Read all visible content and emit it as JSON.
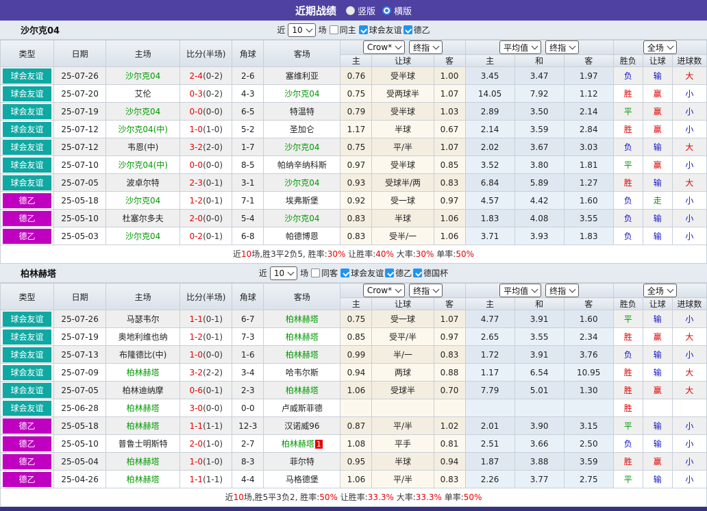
{
  "title_bar": {
    "title": "近期战绩",
    "vertical": "竖版",
    "horizontal": "横版"
  },
  "colors": {
    "accent_purple": "#4e41a1",
    "bottom_bar": "#38317d",
    "friendly_teal": "#0fa8a2",
    "league2_magenta": "#c000c0",
    "team_highlight_green": "#009900",
    "score_red": "#e60000",
    "win_red": "#dd0000",
    "lose_blue": "#1414cc",
    "draw_green": "#009900"
  },
  "table_header": {
    "type": "类型",
    "date": "日期",
    "home": "主场",
    "score": "比分(半场)",
    "corner": "角球",
    "away": "客场",
    "crow": "Crow*",
    "final": "终指",
    "avg": "平均值",
    "final2": "终指",
    "full": "全场",
    "h": "主",
    "handicap": "让球",
    "a": "客",
    "avg_h": "主",
    "avg_d": "和",
    "avg_a": "客",
    "wdl": "胜负",
    "let": "让球",
    "goals": "进球数"
  },
  "sections": [
    {
      "team": "沙尔克04",
      "filter": {
        "near": "近",
        "count": "10",
        "games": "场",
        "same": "同主",
        "leagues": [
          "球会友谊",
          "德乙"
        ]
      },
      "rows": [
        {
          "type": "球会友谊",
          "type_color": "#0fa8a2",
          "date": "25-07-26",
          "home": "沙尔克04",
          "home_hl": 1,
          "score": "2-4",
          "half": "(0-2)",
          "corners": "2-6",
          "away": "塞维利亚",
          "away_hl": 0,
          "away_badge": "",
          "crow_home": "0.76",
          "crow_line": "受半球",
          "crow_away": "1.00",
          "avg_home": "3.45",
          "avg_draw": "3.47",
          "avg_away": "1.97",
          "res_wdl": "负",
          "res_handicap": "输",
          "res_goals": "大"
        },
        {
          "type": "球会友谊",
          "type_color": "#0fa8a2",
          "date": "25-07-20",
          "home": "艾伦",
          "home_hl": 0,
          "score": "0-3",
          "half": "(0-2)",
          "corners": "4-3",
          "away": "沙尔克04",
          "away_hl": 1,
          "away_badge": "",
          "crow_home": "0.75",
          "crow_line": "受两球半",
          "crow_away": "1.07",
          "avg_home": "14.05",
          "avg_draw": "7.92",
          "avg_away": "1.12",
          "res_wdl": "胜",
          "res_handicap": "赢",
          "res_goals": "小"
        },
        {
          "type": "球会友谊",
          "type_color": "#0fa8a2",
          "date": "25-07-19",
          "home": "沙尔克04",
          "home_hl": 1,
          "score": "0-0",
          "half": "(0-0)",
          "corners": "6-5",
          "away": "特温特",
          "away_hl": 0,
          "away_badge": "",
          "crow_home": "0.79",
          "crow_line": "受半球",
          "crow_away": "1.03",
          "avg_home": "2.89",
          "avg_draw": "3.50",
          "avg_away": "2.14",
          "res_wdl": "平",
          "res_handicap": "赢",
          "res_goals": "小"
        },
        {
          "type": "球会友谊",
          "type_color": "#0fa8a2",
          "date": "25-07-12",
          "home": "沙尔克04(中)",
          "home_hl": 1,
          "score": "1-0",
          "half": "(1-0)",
          "corners": "5-2",
          "away": "圣加仑",
          "away_hl": 0,
          "away_badge": "",
          "crow_home": "1.17",
          "crow_line": "半球",
          "crow_away": "0.67",
          "avg_home": "2.14",
          "avg_draw": "3.59",
          "avg_away": "2.84",
          "res_wdl": "胜",
          "res_handicap": "赢",
          "res_goals": "小"
        },
        {
          "type": "球会友谊",
          "type_color": "#0fa8a2",
          "date": "25-07-12",
          "home": "韦恩(中)",
          "home_hl": 0,
          "score": "3-2",
          "half": "(2-0)",
          "corners": "1-7",
          "away": "沙尔克04",
          "away_hl": 1,
          "away_badge": "",
          "crow_home": "0.75",
          "crow_line": "平/半",
          "crow_away": "1.07",
          "avg_home": "2.02",
          "avg_draw": "3.67",
          "avg_away": "3.03",
          "res_wdl": "负",
          "res_handicap": "输",
          "res_goals": "大"
        },
        {
          "type": "球会友谊",
          "type_color": "#0fa8a2",
          "date": "25-07-10",
          "home": "沙尔克04(中)",
          "home_hl": 1,
          "score": "0-0",
          "half": "(0-0)",
          "corners": "8-5",
          "away": "帕纳辛纳科斯",
          "away_hl": 0,
          "away_badge": "",
          "crow_home": "0.97",
          "crow_line": "受半球",
          "crow_away": "0.85",
          "avg_home": "3.52",
          "avg_draw": "3.80",
          "avg_away": "1.81",
          "res_wdl": "平",
          "res_handicap": "赢",
          "res_goals": "小"
        },
        {
          "type": "球会友谊",
          "type_color": "#0fa8a2",
          "date": "25-07-05",
          "home": "波卓尔特",
          "home_hl": 0,
          "score": "2-3",
          "half": "(0-1)",
          "corners": "3-1",
          "away": "沙尔克04",
          "away_hl": 1,
          "away_badge": "",
          "crow_home": "0.93",
          "crow_line": "受球半/两",
          "crow_away": "0.83",
          "avg_home": "6.84",
          "avg_draw": "5.89",
          "avg_away": "1.27",
          "res_wdl": "胜",
          "res_handicap": "输",
          "res_goals": "大"
        },
        {
          "type": "德乙",
          "type_color": "#c000c0",
          "date": "25-05-18",
          "home": "沙尔克04",
          "home_hl": 1,
          "score": "1-2",
          "half": "(0-1)",
          "corners": "7-1",
          "away": "埃弗斯堡",
          "away_hl": 0,
          "away_badge": "",
          "crow_home": "0.92",
          "crow_line": "受一球",
          "crow_away": "0.97",
          "avg_home": "4.57",
          "avg_draw": "4.42",
          "avg_away": "1.60",
          "res_wdl": "负",
          "res_handicap": "走",
          "res_goals": "小"
        },
        {
          "type": "德乙",
          "type_color": "#c000c0",
          "date": "25-05-10",
          "home": "杜塞尔多夫",
          "home_hl": 0,
          "score": "2-0",
          "half": "(0-0)",
          "corners": "5-4",
          "away": "沙尔克04",
          "away_hl": 1,
          "away_badge": "",
          "crow_home": "0.83",
          "crow_line": "半球",
          "crow_away": "1.06",
          "avg_home": "1.83",
          "avg_draw": "4.08",
          "avg_away": "3.55",
          "res_wdl": "负",
          "res_handicap": "输",
          "res_goals": "小"
        },
        {
          "type": "德乙",
          "type_color": "#c000c0",
          "date": "25-05-03",
          "home": "沙尔克04",
          "home_hl": 1,
          "score": "0-2",
          "half": "(0-1)",
          "corners": "6-8",
          "away": "帕德博恩",
          "away_hl": 0,
          "away_badge": "",
          "crow_home": "0.83",
          "crow_line": "受半/一",
          "crow_away": "1.06",
          "avg_home": "3.71",
          "avg_draw": "3.93",
          "avg_away": "1.83",
          "res_wdl": "负",
          "res_handicap": "输",
          "res_goals": "小"
        }
      ],
      "summary": {
        "pre": "近",
        "count": "10",
        "mid": "场,胜3平2负5, 胜率:",
        "win": "30%",
        "l2": " 让胜率:",
        "v2": "40%",
        "l3": " 大率:",
        "v3": "30%",
        "l4": " 单率:",
        "v4": "50%"
      }
    },
    {
      "team": "柏林赫塔",
      "filter": {
        "near": "近",
        "count": "10",
        "games": "场",
        "same": "同客",
        "leagues": [
          "球会友谊",
          "德乙",
          "德国杯"
        ]
      },
      "rows": [
        {
          "type": "球会友谊",
          "type_color": "#0fa8a2",
          "date": "25-07-26",
          "home": "马瑟韦尔",
          "home_hl": 0,
          "score": "1-1",
          "half": "(0-1)",
          "corners": "6-7",
          "away": "柏林赫塔",
          "away_hl": 1,
          "away_badge": "",
          "crow_home": "0.75",
          "crow_line": "受一球",
          "crow_away": "1.07",
          "avg_home": "4.77",
          "avg_draw": "3.91",
          "avg_away": "1.60",
          "res_wdl": "平",
          "res_handicap": "输",
          "res_goals": "小"
        },
        {
          "type": "球会友谊",
          "type_color": "#0fa8a2",
          "date": "25-07-19",
          "home": "奥地利维也纳",
          "home_hl": 0,
          "score": "1-2",
          "half": "(0-1)",
          "corners": "7-3",
          "away": "柏林赫塔",
          "away_hl": 1,
          "away_badge": "",
          "crow_home": "0.85",
          "crow_line": "受平/半",
          "crow_away": "0.97",
          "avg_home": "2.65",
          "avg_draw": "3.55",
          "avg_away": "2.34",
          "res_wdl": "胜",
          "res_handicap": "赢",
          "res_goals": "大"
        },
        {
          "type": "球会友谊",
          "type_color": "#0fa8a2",
          "date": "25-07-13",
          "home": "布隆德比(中)",
          "home_hl": 0,
          "score": "1-0",
          "half": "(0-0)",
          "corners": "1-6",
          "away": "柏林赫塔",
          "away_hl": 1,
          "away_badge": "",
          "crow_home": "0.99",
          "crow_line": "半/一",
          "crow_away": "0.83",
          "avg_home": "1.72",
          "avg_draw": "3.91",
          "avg_away": "3.76",
          "res_wdl": "负",
          "res_handicap": "输",
          "res_goals": "小"
        },
        {
          "type": "球会友谊",
          "type_color": "#0fa8a2",
          "date": "25-07-09",
          "home": "柏林赫塔",
          "home_hl": 1,
          "score": "3-2",
          "half": "(2-2)",
          "corners": "3-4",
          "away": "哈韦尔斯",
          "away_hl": 0,
          "away_badge": "",
          "crow_home": "0.94",
          "crow_line": "两球",
          "crow_away": "0.88",
          "avg_home": "1.17",
          "avg_draw": "6.54",
          "avg_away": "10.95",
          "res_wdl": "胜",
          "res_handicap": "输",
          "res_goals": "大"
        },
        {
          "type": "球会友谊",
          "type_color": "#0fa8a2",
          "date": "25-07-05",
          "home": "柏林迪纳摩",
          "home_hl": 0,
          "score": "0-6",
          "half": "(0-1)",
          "corners": "2-3",
          "away": "柏林赫塔",
          "away_hl": 1,
          "away_badge": "",
          "crow_home": "1.06",
          "crow_line": "受球半",
          "crow_away": "0.70",
          "avg_home": "7.79",
          "avg_draw": "5.01",
          "avg_away": "1.30",
          "res_wdl": "胜",
          "res_handicap": "赢",
          "res_goals": "大"
        },
        {
          "type": "球会友谊",
          "type_color": "#0fa8a2",
          "date": "25-06-28",
          "home": "柏林赫塔",
          "home_hl": 1,
          "score": "3-0",
          "half": "(0-0)",
          "corners": "0-0",
          "away": "卢威斯菲德",
          "away_hl": 0,
          "away_badge": "",
          "crow_home": "",
          "crow_line": "",
          "crow_away": "",
          "avg_home": "",
          "avg_draw": "",
          "avg_away": "",
          "res_wdl": "胜",
          "res_handicap": "",
          "res_goals": ""
        },
        {
          "type": "德乙",
          "type_color": "#c000c0",
          "date": "25-05-18",
          "home": "柏林赫塔",
          "home_hl": 1,
          "score": "1-1",
          "half": "(1-1)",
          "corners": "12-3",
          "away": "汉诺威96",
          "away_hl": 0,
          "away_badge": "",
          "crow_home": "0.87",
          "crow_line": "平/半",
          "crow_away": "1.02",
          "avg_home": "2.01",
          "avg_draw": "3.90",
          "avg_away": "3.15",
          "res_wdl": "平",
          "res_handicap": "输",
          "res_goals": "小"
        },
        {
          "type": "德乙",
          "type_color": "#c000c0",
          "date": "25-05-10",
          "home": "普鲁士明斯特",
          "home_hl": 0,
          "score": "2-0",
          "half": "(1-0)",
          "corners": "2-7",
          "away": "柏林赫塔",
          "away_hl": 1,
          "away_badge": "1",
          "crow_home": "1.08",
          "crow_line": "平手",
          "crow_away": "0.81",
          "avg_home": "2.51",
          "avg_draw": "3.66",
          "avg_away": "2.50",
          "res_wdl": "负",
          "res_handicap": "输",
          "res_goals": "小"
        },
        {
          "type": "德乙",
          "type_color": "#c000c0",
          "date": "25-05-04",
          "home": "柏林赫塔",
          "home_hl": 1,
          "score": "1-0",
          "half": "(1-0)",
          "corners": "8-3",
          "away": "菲尔特",
          "away_hl": 0,
          "away_badge": "",
          "crow_home": "0.95",
          "crow_line": "半球",
          "crow_away": "0.94",
          "avg_home": "1.87",
          "avg_draw": "3.88",
          "avg_away": "3.59",
          "res_wdl": "胜",
          "res_handicap": "赢",
          "res_goals": "小"
        },
        {
          "type": "德乙",
          "type_color": "#c000c0",
          "date": "25-04-26",
          "home": "柏林赫塔",
          "home_hl": 1,
          "score": "1-1",
          "half": "(1-1)",
          "corners": "4-4",
          "away": "马格德堡",
          "away_hl": 0,
          "away_badge": "",
          "crow_home": "1.06",
          "crow_line": "平/半",
          "crow_away": "0.83",
          "avg_home": "2.26",
          "avg_draw": "3.77",
          "avg_away": "2.75",
          "res_wdl": "平",
          "res_handicap": "输",
          "res_goals": "小"
        }
      ],
      "summary": {
        "pre": "近",
        "count": "10",
        "mid": "场,胜5平3负2, 胜率:",
        "win": "50%",
        "l2": " 让胜率:",
        "v2": "33.3%",
        "l3": " 大率:",
        "v3": "33.3%",
        "l4": " 单率:",
        "v4": "50%"
      }
    }
  ]
}
